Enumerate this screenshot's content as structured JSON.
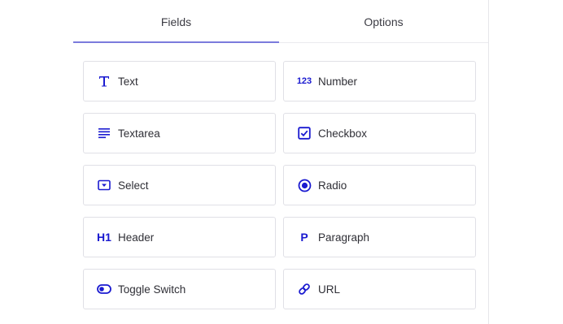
{
  "tabs": [
    {
      "label": "Fields",
      "active": true
    },
    {
      "label": "Options",
      "active": false
    }
  ],
  "accent_color": "#1a1ad0",
  "tab_underline_color": "#7b7bdc",
  "fields": [
    {
      "label": "Text",
      "icon": "text-icon"
    },
    {
      "label": "Number",
      "icon": "number-icon",
      "icon_text": "123"
    },
    {
      "label": "Textarea",
      "icon": "textarea-icon"
    },
    {
      "label": "Checkbox",
      "icon": "checkbox-icon"
    },
    {
      "label": "Select",
      "icon": "select-icon"
    },
    {
      "label": "Radio",
      "icon": "radio-icon"
    },
    {
      "label": "Header",
      "icon": "header-icon",
      "icon_text": "H1"
    },
    {
      "label": "Paragraph",
      "icon": "paragraph-icon",
      "icon_text": "P"
    },
    {
      "label": "Toggle Switch",
      "icon": "toggle-icon"
    },
    {
      "label": "URL",
      "icon": "link-icon"
    }
  ]
}
